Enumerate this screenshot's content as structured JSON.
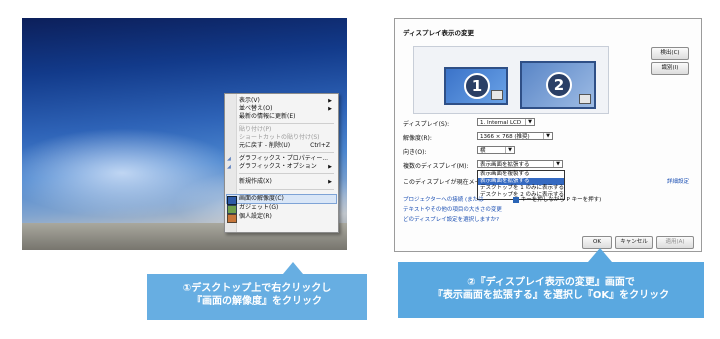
{
  "desktop_menu": {
    "items": [
      {
        "label": "表示(V)",
        "arrow": true,
        "disabled": false
      },
      {
        "label": "並べ替え(O)",
        "arrow": true,
        "disabled": false
      },
      {
        "label": "最新の情報に更新(E)",
        "arrow": false,
        "disabled": false
      },
      {
        "label": "貼り付け(P)",
        "arrow": false,
        "disabled": true
      },
      {
        "label": "ショートカットの貼り付け(S)",
        "arrow": false,
        "disabled": true
      },
      {
        "label": "元に戻す - 削除(U)",
        "shortcut": "Ctrl+Z",
        "arrow": false,
        "disabled": false
      },
      {
        "label": "グラフィックス・プロパティー...",
        "arrow": false,
        "disabled": false
      },
      {
        "label": "グラフィックス・オプション",
        "arrow": true,
        "disabled": false
      },
      {
        "label": "新規作成(X)",
        "arrow": true,
        "disabled": false
      },
      {
        "label": "画面の解像度(C)",
        "arrow": false,
        "disabled": false,
        "highlighted": true
      },
      {
        "label": "ガジェット(G)",
        "arrow": false,
        "disabled": false
      },
      {
        "label": "個人設定(R)",
        "arrow": false,
        "disabled": false
      }
    ]
  },
  "dialog": {
    "title": "ディスプレイ表示の変更",
    "monitor1_number": "1",
    "monitor2_number": "2",
    "detect_button": "検出(C)",
    "identify_button": "識別(I)",
    "display_label": "ディスプレイ(S):",
    "display_value": "1. Internal LCD",
    "resolution_label": "解像度(R):",
    "resolution_value": "1366 × 768 (推奨)",
    "orientation_label": "向き(O):",
    "orientation_value": "横",
    "multi_label": "複数のディスプレイ(M):",
    "multi_value": "表示画面を拡張する",
    "dropdown_options": [
      "表示画面を複製する",
      "表示画面を拡張する",
      "デスクトップを 1 のみに表示する",
      "デスクトップを 2 のみに表示する"
    ],
    "dropdown_selected_index": 1,
    "primary_text": "このディスプレイが現在メイン",
    "advanced_link": "詳細設定",
    "projector_link": "プロジェクターへの接続 (または",
    "projector_suffix": "キーを押しながら P キーを押す)",
    "text_size_link": "テキストやその他の項目の大きさの変更",
    "which_settings_link": "どのディスプレイ設定を選択しますか?",
    "ok_button": "OK",
    "cancel_button": "キャンセル",
    "apply_button": "適用(A)"
  },
  "callout1": {
    "line1": "①デスクトップ上で右クリックし",
    "line2": "『画面の解像度』をクリック"
  },
  "callout2": {
    "line1": "②『ディスプレイ表示の変更』画面で",
    "line2": "『表示画面を拡張する』を選択し『OK』をクリック"
  },
  "colors": {
    "callout": "#67aee2",
    "highlight": "#3469c1"
  }
}
